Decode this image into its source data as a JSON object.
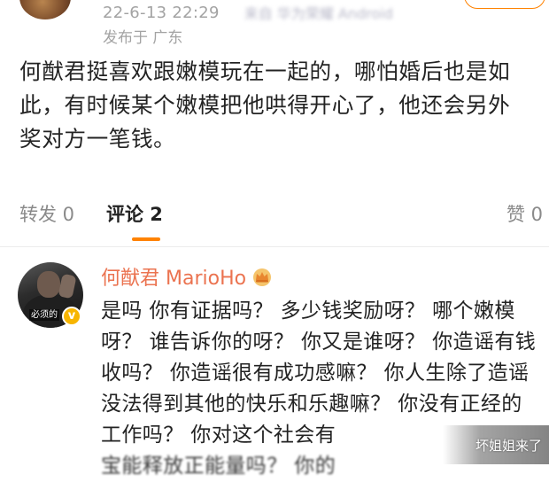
{
  "post": {
    "time": "22-6-13 22:29",
    "device": "来自 华为荣耀 Android",
    "location": "发布于 广东",
    "follow_label": "",
    "body_lines": [
      "何猷君挺喜欢跟嫩模玩在一起的，哪怕婚后也是如",
      "此，有时候某个嫩模把他哄得开心了，他还会另外",
      "奖对方一笔钱。"
    ]
  },
  "actions": {
    "repost": "转发 0",
    "comment": "评论 2",
    "like": "赞 0"
  },
  "comment": {
    "avatar_caption": "必须的",
    "author": "何猷君 MarioHo",
    "lines": [
      "是吗 你有证据吗？ 多少钱奖励呀？ 哪个嫩模",
      "呀？ 谁告诉你的呀？ 你又是谁呀？ 你造谣有钱",
      "收吗？ 你造谣很有成功感嘛？ 你人生除了造谣",
      "没法得到其他的快乐和乐趣嘛？ 你没有正经的",
      "工作吗？ 你对这个社会有",
      "宝能释放正能量吗？ 你的"
    ]
  },
  "watermark": "坏姐姐来了",
  "colors": {
    "accent": "#ff8200",
    "author_name": "#eb7350",
    "muted": "#a3a3a3"
  },
  "icons": [
    "crown-icon",
    "verified-badge-icon"
  ]
}
